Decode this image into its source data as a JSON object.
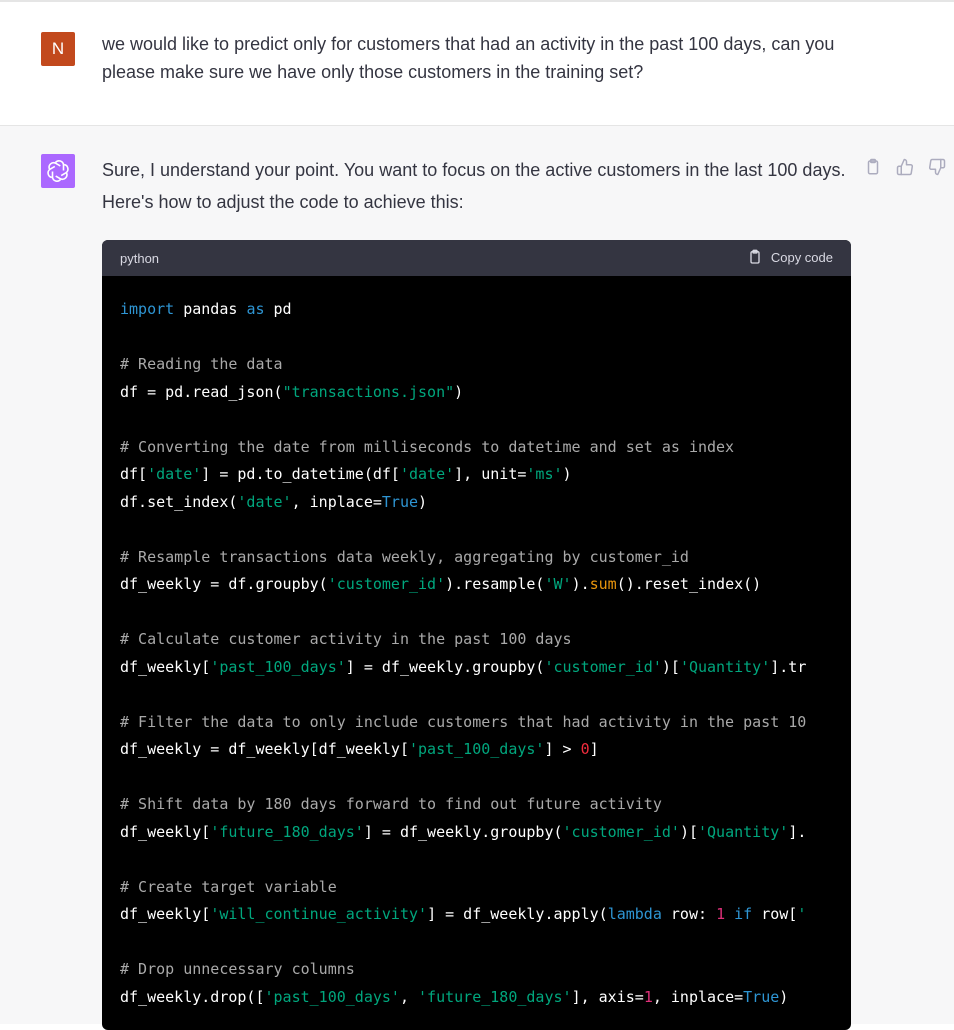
{
  "user_message": {
    "avatar_letter": "N",
    "text": "we would like to predict only for customers that had an activity in the past 100 days, can you please make sure we have only those customers in the training set?"
  },
  "assistant_message": {
    "intro": "Sure, I understand your point. You want to focus on the active customers in the last 100 days. Here's how to adjust the code to achieve this:",
    "actions": [
      "clipboard-icon",
      "thumbs-up-icon",
      "thumbs-down-icon"
    ],
    "code": {
      "language": "python",
      "copy_label": "Copy code",
      "lines": [
        [
          {
            "t": "import",
            "c": "kw"
          },
          {
            "t": " pandas "
          },
          {
            "t": "as",
            "c": "kw"
          },
          {
            "t": " pd"
          }
        ],
        [],
        [
          {
            "t": "# Reading the data",
            "c": "cm"
          }
        ],
        [
          {
            "t": "df = pd.read_json("
          },
          {
            "t": "\"transactions.json\"",
            "c": "st"
          },
          {
            "t": ")"
          }
        ],
        [],
        [
          {
            "t": "# Converting the date from milliseconds to datetime and set as index",
            "c": "cm"
          }
        ],
        [
          {
            "t": "df["
          },
          {
            "t": "'date'",
            "c": "st"
          },
          {
            "t": "] = pd.to_datetime(df["
          },
          {
            "t": "'date'",
            "c": "st"
          },
          {
            "t": "], unit="
          },
          {
            "t": "'ms'",
            "c": "st"
          },
          {
            "t": ")"
          }
        ],
        [
          {
            "t": "df.set_index("
          },
          {
            "t": "'date'",
            "c": "st"
          },
          {
            "t": ", inplace="
          },
          {
            "t": "True",
            "c": "kw"
          },
          {
            "t": ")"
          }
        ],
        [],
        [
          {
            "t": "# Resample transactions data weekly, aggregating by customer_id",
            "c": "cm"
          }
        ],
        [
          {
            "t": "df_weekly = df.groupby("
          },
          {
            "t": "'customer_id'",
            "c": "st"
          },
          {
            "t": ").resample("
          },
          {
            "t": "'W'",
            "c": "st"
          },
          {
            "t": ")."
          },
          {
            "t": "sum",
            "c": "bt"
          },
          {
            "t": "().reset_index()"
          }
        ],
        [],
        [
          {
            "t": "# Calculate customer activity in the past 100 days",
            "c": "cm"
          }
        ],
        [
          {
            "t": "df_weekly["
          },
          {
            "t": "'past_100_days'",
            "c": "st"
          },
          {
            "t": "] = df_weekly.groupby("
          },
          {
            "t": "'customer_id'",
            "c": "st"
          },
          {
            "t": ")["
          },
          {
            "t": "'Quantity'",
            "c": "st"
          },
          {
            "t": "].tr"
          }
        ],
        [],
        [
          {
            "t": "# Filter the data to only include customers that had activity in the past 10",
            "c": "cm"
          }
        ],
        [
          {
            "t": "df_weekly = df_weekly[df_weekly["
          },
          {
            "t": "'past_100_days'",
            "c": "st"
          },
          {
            "t": "] > "
          },
          {
            "t": "0",
            "c": "fn"
          },
          {
            "t": "]"
          }
        ],
        [],
        [
          {
            "t": "# Shift data by 180 days forward to find out future activity",
            "c": "cm"
          }
        ],
        [
          {
            "t": "df_weekly["
          },
          {
            "t": "'future_180_days'",
            "c": "st"
          },
          {
            "t": "] = df_weekly.groupby("
          },
          {
            "t": "'customer_id'",
            "c": "st"
          },
          {
            "t": ")["
          },
          {
            "t": "'Quantity'",
            "c": "st"
          },
          {
            "t": "]."
          }
        ],
        [],
        [
          {
            "t": "# Create target variable",
            "c": "cm"
          }
        ],
        [
          {
            "t": "df_weekly["
          },
          {
            "t": "'will_continue_activity'",
            "c": "st"
          },
          {
            "t": "] = df_weekly.apply("
          },
          {
            "t": "lambda",
            "c": "kw"
          },
          {
            "t": " row: "
          },
          {
            "t": "1",
            "c": "nm"
          },
          {
            "t": " "
          },
          {
            "t": "if",
            "c": "kw"
          },
          {
            "t": " row["
          },
          {
            "t": "'",
            "c": "st"
          }
        ],
        [],
        [
          {
            "t": "# Drop unnecessary columns",
            "c": "cm"
          }
        ],
        [
          {
            "t": "df_weekly.drop(["
          },
          {
            "t": "'past_100_days'",
            "c": "st"
          },
          {
            "t": ", "
          },
          {
            "t": "'future_180_days'",
            "c": "st"
          },
          {
            "t": "], axis="
          },
          {
            "t": "1",
            "c": "nm"
          },
          {
            "t": ", inplace="
          },
          {
            "t": "True",
            "c": "kw"
          },
          {
            "t": ")"
          }
        ]
      ]
    }
  },
  "colors": {
    "user_avatar": "#c2491d",
    "assistant_avatar": "#ab68ff",
    "code_background": "#000000",
    "code_header": "#343541",
    "keyword": "#2e95d3",
    "string": "#00a67d",
    "comment": "#a9a9a9",
    "number": "#df3079",
    "builtin": "#e9950c"
  }
}
